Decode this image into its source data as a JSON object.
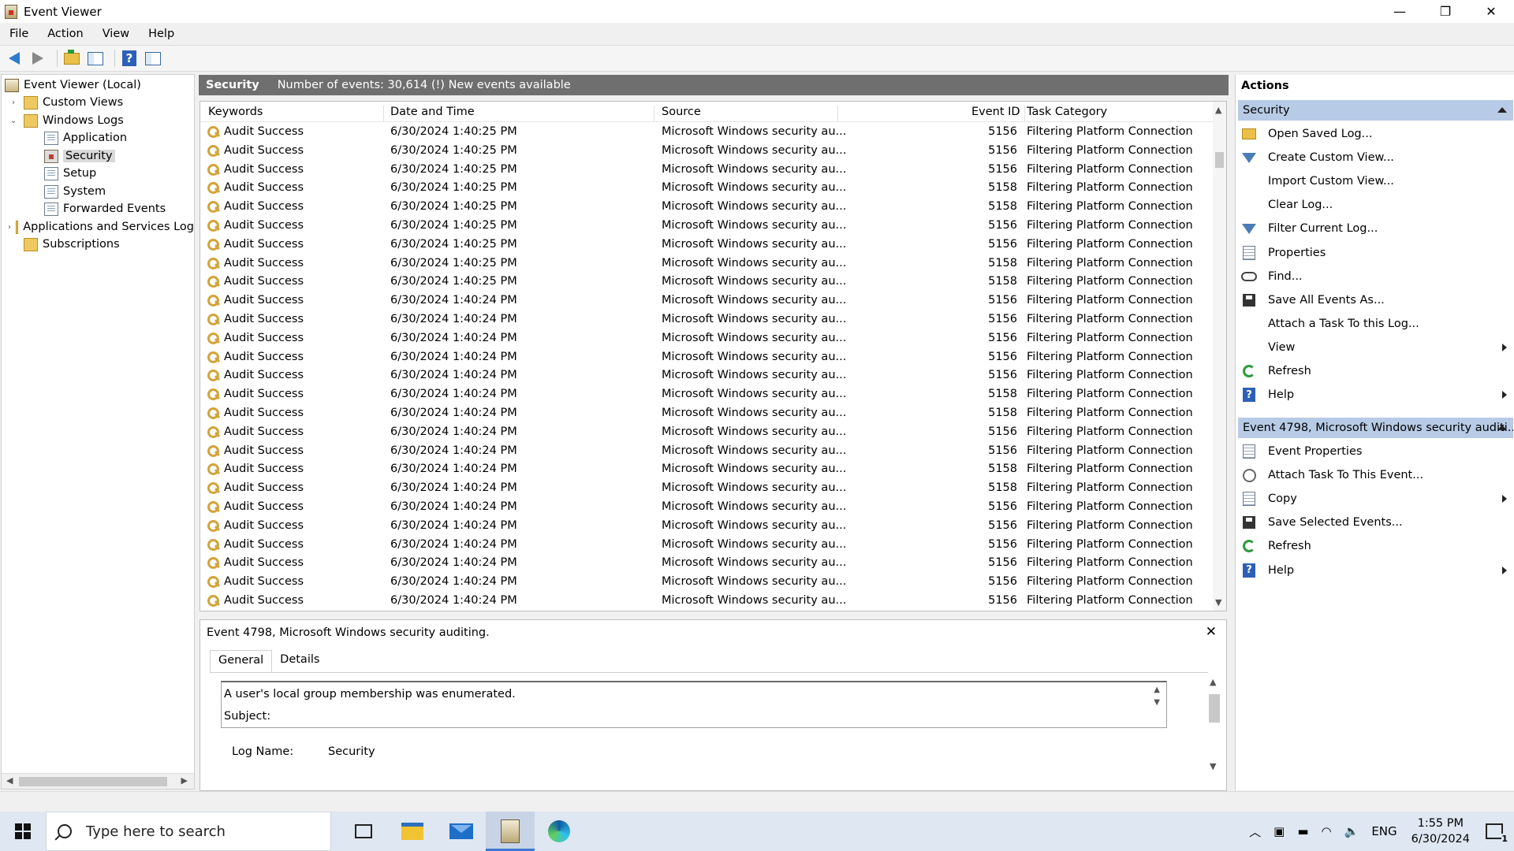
{
  "window": {
    "title": "Event Viewer",
    "controls": [
      "—",
      "❐",
      "✕"
    ]
  },
  "menu": [
    "File",
    "Action",
    "View",
    "Help"
  ],
  "tree": {
    "items": [
      {
        "label": "Event Viewer (Local)",
        "icon": "event-viewer-icon",
        "depth": 0,
        "expander": ""
      },
      {
        "label": "Custom Views",
        "icon": "folder-icon",
        "depth": 1,
        "expander": "›"
      },
      {
        "label": "Windows Logs",
        "icon": "folder-icon",
        "depth": 1,
        "expander": "⌄"
      },
      {
        "label": "Application",
        "icon": "log-icon",
        "depth": 2,
        "expander": ""
      },
      {
        "label": "Security",
        "icon": "security-log-icon",
        "depth": 2,
        "expander": "",
        "selected": true
      },
      {
        "label": "Setup",
        "icon": "log-icon",
        "depth": 2,
        "expander": ""
      },
      {
        "label": "System",
        "icon": "log-icon",
        "depth": 2,
        "expander": ""
      },
      {
        "label": "Forwarded Events",
        "icon": "log-icon",
        "depth": 2,
        "expander": ""
      },
      {
        "label": "Applications and Services Log",
        "icon": "folder-icon",
        "depth": 1,
        "expander": "›"
      },
      {
        "label": "Subscriptions",
        "icon": "folder-icon",
        "depth": 1,
        "expander": ""
      }
    ]
  },
  "center": {
    "log_name": "Security",
    "event_count_text": "Number of events: 30,614 (!) New events available",
    "columns": [
      "Keywords",
      "Date and Time",
      "Source",
      "Event ID",
      "Task Category"
    ],
    "rows": [
      [
        "Audit Success",
        "6/30/2024 1:40:25 PM",
        "Microsoft Windows security au...",
        "5156",
        "Filtering Platform Connection"
      ],
      [
        "Audit Success",
        "6/30/2024 1:40:25 PM",
        "Microsoft Windows security au...",
        "5156",
        "Filtering Platform Connection"
      ],
      [
        "Audit Success",
        "6/30/2024 1:40:25 PM",
        "Microsoft Windows security au...",
        "5156",
        "Filtering Platform Connection"
      ],
      [
        "Audit Success",
        "6/30/2024 1:40:25 PM",
        "Microsoft Windows security au...",
        "5158",
        "Filtering Platform Connection"
      ],
      [
        "Audit Success",
        "6/30/2024 1:40:25 PM",
        "Microsoft Windows security au...",
        "5158",
        "Filtering Platform Connection"
      ],
      [
        "Audit Success",
        "6/30/2024 1:40:25 PM",
        "Microsoft Windows security au...",
        "5156",
        "Filtering Platform Connection"
      ],
      [
        "Audit Success",
        "6/30/2024 1:40:25 PM",
        "Microsoft Windows security au...",
        "5156",
        "Filtering Platform Connection"
      ],
      [
        "Audit Success",
        "6/30/2024 1:40:25 PM",
        "Microsoft Windows security au...",
        "5158",
        "Filtering Platform Connection"
      ],
      [
        "Audit Success",
        "6/30/2024 1:40:25 PM",
        "Microsoft Windows security au...",
        "5158",
        "Filtering Platform Connection"
      ],
      [
        "Audit Success",
        "6/30/2024 1:40:24 PM",
        "Microsoft Windows security au...",
        "5156",
        "Filtering Platform Connection"
      ],
      [
        "Audit Success",
        "6/30/2024 1:40:24 PM",
        "Microsoft Windows security au...",
        "5156",
        "Filtering Platform Connection"
      ],
      [
        "Audit Success",
        "6/30/2024 1:40:24 PM",
        "Microsoft Windows security au...",
        "5156",
        "Filtering Platform Connection"
      ],
      [
        "Audit Success",
        "6/30/2024 1:40:24 PM",
        "Microsoft Windows security au...",
        "5156",
        "Filtering Platform Connection"
      ],
      [
        "Audit Success",
        "6/30/2024 1:40:24 PM",
        "Microsoft Windows security au...",
        "5156",
        "Filtering Platform Connection"
      ],
      [
        "Audit Success",
        "6/30/2024 1:40:24 PM",
        "Microsoft Windows security au...",
        "5158",
        "Filtering Platform Connection"
      ],
      [
        "Audit Success",
        "6/30/2024 1:40:24 PM",
        "Microsoft Windows security au...",
        "5158",
        "Filtering Platform Connection"
      ],
      [
        "Audit Success",
        "6/30/2024 1:40:24 PM",
        "Microsoft Windows security au...",
        "5156",
        "Filtering Platform Connection"
      ],
      [
        "Audit Success",
        "6/30/2024 1:40:24 PM",
        "Microsoft Windows security au...",
        "5156",
        "Filtering Platform Connection"
      ],
      [
        "Audit Success",
        "6/30/2024 1:40:24 PM",
        "Microsoft Windows security au...",
        "5158",
        "Filtering Platform Connection"
      ],
      [
        "Audit Success",
        "6/30/2024 1:40:24 PM",
        "Microsoft Windows security au...",
        "5158",
        "Filtering Platform Connection"
      ],
      [
        "Audit Success",
        "6/30/2024 1:40:24 PM",
        "Microsoft Windows security au...",
        "5156",
        "Filtering Platform Connection"
      ],
      [
        "Audit Success",
        "6/30/2024 1:40:24 PM",
        "Microsoft Windows security au...",
        "5156",
        "Filtering Platform Connection"
      ],
      [
        "Audit Success",
        "6/30/2024 1:40:24 PM",
        "Microsoft Windows security au...",
        "5156",
        "Filtering Platform Connection"
      ],
      [
        "Audit Success",
        "6/30/2024 1:40:24 PM",
        "Microsoft Windows security au...",
        "5156",
        "Filtering Platform Connection"
      ],
      [
        "Audit Success",
        "6/30/2024 1:40:24 PM",
        "Microsoft Windows security au...",
        "5156",
        "Filtering Platform Connection"
      ],
      [
        "Audit Success",
        "6/30/2024 1:40:24 PM",
        "Microsoft Windows security au...",
        "5156",
        "Filtering Platform Connection"
      ]
    ]
  },
  "detail": {
    "title": "Event 4798, Microsoft Windows security auditing.",
    "close": "✕",
    "tabs": [
      "General",
      "Details"
    ],
    "message_line1": "A user's local group membership was enumerated.",
    "message_line2": "Subject:",
    "log_name_label": "Log Name:",
    "log_name_value": "Security"
  },
  "actions": {
    "title": "Actions",
    "section1": {
      "label": "Security",
      "items": [
        {
          "label": "Open Saved Log...",
          "icon": "open-folder-icon",
          "submenu": false
        },
        {
          "label": "Create Custom View...",
          "icon": "filter-icon",
          "submenu": false
        },
        {
          "label": "Import Custom View...",
          "icon": "",
          "submenu": false
        },
        {
          "label": "Clear Log...",
          "icon": "",
          "submenu": false
        },
        {
          "label": "Filter Current Log...",
          "icon": "filter-icon",
          "submenu": false
        },
        {
          "label": "Properties",
          "icon": "properties-icon",
          "submenu": false
        },
        {
          "label": "Find...",
          "icon": "binoculars-icon",
          "submenu": false
        },
        {
          "label": "Save All Events As...",
          "icon": "save-icon",
          "submenu": false
        },
        {
          "label": "Attach a Task To this Log...",
          "icon": "",
          "submenu": false
        },
        {
          "label": "View",
          "icon": "",
          "submenu": true
        },
        {
          "label": "Refresh",
          "icon": "refresh-icon",
          "submenu": false
        },
        {
          "label": "Help",
          "icon": "help-icon",
          "submenu": true
        }
      ]
    },
    "section2": {
      "label": "Event 4798, Microsoft Windows security auditi...",
      "items": [
        {
          "label": "Event Properties",
          "icon": "properties-icon",
          "submenu": false
        },
        {
          "label": "Attach Task To This Event...",
          "icon": "task-icon",
          "submenu": false
        },
        {
          "label": "Copy",
          "icon": "copy-icon",
          "submenu": true
        },
        {
          "label": "Save Selected Events...",
          "icon": "save-icon",
          "submenu": false
        },
        {
          "label": "Refresh",
          "icon": "refresh-icon",
          "submenu": false
        },
        {
          "label": "Help",
          "icon": "help-icon",
          "submenu": true
        }
      ]
    }
  },
  "taskbar": {
    "search_placeholder": "Type here to search",
    "tray": {
      "language": "ENG",
      "time": "1:55 PM",
      "date": "6/30/2024",
      "notification_count": "1"
    }
  }
}
